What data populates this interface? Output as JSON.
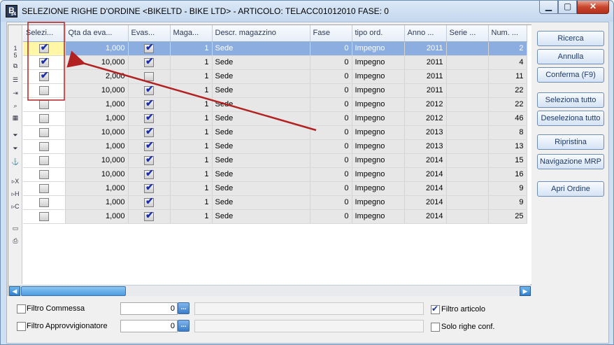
{
  "window": {
    "title": "SELEZIONE RIGHE D'ORDINE <BIKELTD - BIKE LTD> - ARTICOLO: TELACC01012010 FASE: 0",
    "icon_letter": "B",
    "icon_sub": "14",
    "minimize_icon": "minimize-icon",
    "maximize_icon": "maximize-icon",
    "close_icon": "close-icon"
  },
  "grid": {
    "columns": [
      "Selezi...",
      "Qta da eva...",
      "Evas...",
      "Maga...",
      "Descr. magazzino",
      "Fase",
      "tipo ord.",
      "Anno ...",
      "Serie ...",
      "Num. ..."
    ],
    "rows": [
      {
        "sel": true,
        "qta": "1,000",
        "evas": true,
        "mag": "1",
        "descr": "Sede",
        "fase": "0",
        "tipo": "Impegno",
        "anno": "2011",
        "serie": "",
        "num": "2"
      },
      {
        "sel": true,
        "qta": "10,000",
        "evas": true,
        "mag": "1",
        "descr": "Sede",
        "fase": "0",
        "tipo": "Impegno",
        "anno": "2011",
        "serie": "",
        "num": "4"
      },
      {
        "sel": true,
        "qta": "2,000",
        "evas": false,
        "mag": "1",
        "descr": "Sede",
        "fase": "0",
        "tipo": "Impegno",
        "anno": "2011",
        "serie": "",
        "num": "11"
      },
      {
        "sel": false,
        "qta": "10,000",
        "evas": true,
        "mag": "1",
        "descr": "Sede",
        "fase": "0",
        "tipo": "Impegno",
        "anno": "2011",
        "serie": "",
        "num": "22"
      },
      {
        "sel": false,
        "qta": "1,000",
        "evas": true,
        "mag": "1",
        "descr": "Sede",
        "fase": "0",
        "tipo": "Impegno",
        "anno": "2012",
        "serie": "",
        "num": "22"
      },
      {
        "sel": false,
        "qta": "1,000",
        "evas": true,
        "mag": "1",
        "descr": "Sede",
        "fase": "0",
        "tipo": "Impegno",
        "anno": "2012",
        "serie": "",
        "num": "46"
      },
      {
        "sel": false,
        "qta": "10,000",
        "evas": true,
        "mag": "1",
        "descr": "Sede",
        "fase": "0",
        "tipo": "Impegno",
        "anno": "2013",
        "serie": "",
        "num": "8"
      },
      {
        "sel": false,
        "qta": "1,000",
        "evas": true,
        "mag": "1",
        "descr": "Sede",
        "fase": "0",
        "tipo": "Impegno",
        "anno": "2013",
        "serie": "",
        "num": "13"
      },
      {
        "sel": false,
        "qta": "10,000",
        "evas": true,
        "mag": "1",
        "descr": "Sede",
        "fase": "0",
        "tipo": "Impegno",
        "anno": "2014",
        "serie": "",
        "num": "15"
      },
      {
        "sel": false,
        "qta": "10,000",
        "evas": true,
        "mag": "1",
        "descr": "Sede",
        "fase": "0",
        "tipo": "Impegno",
        "anno": "2014",
        "serie": "",
        "num": "16"
      },
      {
        "sel": false,
        "qta": "1,000",
        "evas": true,
        "mag": "1",
        "descr": "Sede",
        "fase": "0",
        "tipo": "Impegno",
        "anno": "2014",
        "serie": "",
        "num": "9"
      },
      {
        "sel": false,
        "qta": "1,000",
        "evas": true,
        "mag": "1",
        "descr": "Sede",
        "fase": "0",
        "tipo": "Impegno",
        "anno": "2014",
        "serie": "",
        "num": "9"
      },
      {
        "sel": false,
        "qta": "1,000",
        "evas": true,
        "mag": "1",
        "descr": "Sede",
        "fase": "0",
        "tipo": "Impegno",
        "anno": "2014",
        "serie": "",
        "num": "25"
      }
    ]
  },
  "toolbar_icons": [
    "row-1",
    "row-5",
    "copy-icon",
    "list-icon",
    "import-icon",
    "zoom-icon",
    "grid-icon",
    "filter-icon",
    "filter-remove-icon",
    "anchor-icon",
    "export-x-icon",
    "export-h-icon",
    "export-c-icon",
    "monitor-icon",
    "print-icon"
  ],
  "toolbar_text": {
    "row1": "1",
    "row2": "5"
  },
  "buttons": {
    "ricerca": "Ricerca",
    "annulla": "Annulla",
    "conferma": "Conferma (F9)",
    "seleziona_tutto": "Seleziona tutto",
    "deseleziona_tutto": "Deseleziona tutto",
    "ripristina": "Ripristina",
    "navigazione_mrp": "Navigazione MRP",
    "apri_ordine": "Apri Ordine"
  },
  "filters": {
    "commessa_label": "Filtro Commessa",
    "commessa_value": "0",
    "commessa_checked": false,
    "approvv_label": "Filtro Approvvigionatore",
    "approvv_value": "0",
    "approvv_checked": false,
    "articolo_label": "Filtro articolo",
    "articolo_checked": true,
    "solo_label": "Solo righe conf.",
    "solo_checked": false,
    "lookup_button": "..."
  },
  "colors": {
    "selection": "#8cade0",
    "annotation": "#b22222",
    "accent": "#2d7fd0"
  }
}
